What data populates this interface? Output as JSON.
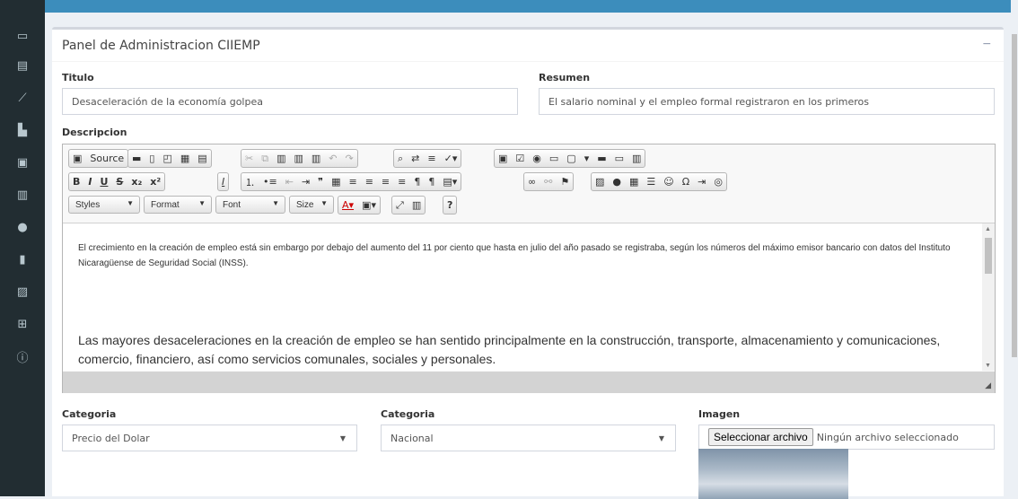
{
  "panel": {
    "title": "Panel de Administracion CIIEMP",
    "collapse": "−"
  },
  "form": {
    "titulo_label": "Titulo",
    "titulo_value": "Desaceleración de la economía golpea",
    "resumen_label": "Resumen",
    "resumen_value": "El salario nominal y el empleo formal registraron en los primeros",
    "descripcion_label": "Descripcion",
    "categoria1_label": "Categoria",
    "categoria1_value": "Precio del Dolar",
    "categoria2_label": "Categoria",
    "categoria2_value": "Nacional",
    "imagen_label": "Imagen",
    "file_button": "Seleccionar archivo",
    "file_status": "Ningún archivo seleccionado"
  },
  "editor": {
    "source_label": "Source",
    "styles": "Styles",
    "format": "Format",
    "font": "Font",
    "size": "Size",
    "help": "?",
    "paragraph1": "El crecimiento en la creación de empleo está sin embargo por debajo del aumento del 11 por ciento que hasta en julio del año pasado se registraba, según los números del máximo emisor bancario con datos del Instituto Nicaragüense de Seguridad Social (INSS).",
    "paragraph2": "Las mayores desaceleraciones en la creación de empleo se han sentido principalmente en la construcción, transporte, almacenamiento y comunicaciones, comercio, financiero, así como servicios comunales, sociales y personales."
  },
  "sidebar_icons": [
    "laptop-icon",
    "id-card-icon",
    "line-chart-icon",
    "bar-chart-icon",
    "pdf-icon",
    "book-icon",
    "comments-icon",
    "file-icon",
    "image-icon",
    "plus-square-icon",
    "info-icon"
  ],
  "colors": {
    "accent": "#3c8dbc",
    "sidebar": "#222d32",
    "background": "#ecf0f5"
  }
}
